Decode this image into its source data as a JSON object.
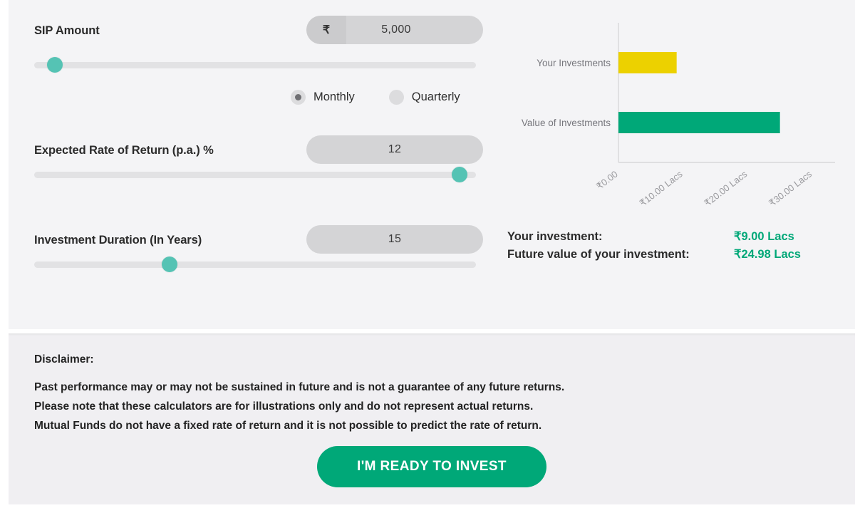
{
  "calculator": {
    "sip_amount": {
      "label": "SIP Amount",
      "currency_symbol": "₹",
      "value": "5,000",
      "slider_percent": 3
    },
    "frequency": {
      "options": [
        {
          "label": "Monthly",
          "selected": true
        },
        {
          "label": "Quarterly",
          "selected": false
        }
      ]
    },
    "rate_of_return": {
      "label": "Expected Rate of Return (p.a.) %",
      "value": "12",
      "slider_percent": 98
    },
    "duration": {
      "label": "Investment Duration (In Years)",
      "value": "15",
      "slider_percent": 30
    }
  },
  "results": {
    "rows": [
      {
        "label": "Your investment:",
        "value": "₹9.00 Lacs"
      },
      {
        "label": "Future value of your investment:",
        "value": "₹24.98 Lacs"
      }
    ]
  },
  "chart_data": {
    "type": "bar",
    "orientation": "horizontal",
    "title": "",
    "xlabel": "",
    "ylabel": "",
    "categories": [
      "Your Investments",
      "Value of Investments"
    ],
    "values": [
      9.0,
      24.98
    ],
    "colors": [
      "#ecd100",
      "#00a878"
    ],
    "xlim": [
      0,
      33.5
    ],
    "tick_values": [
      0,
      10,
      20,
      30
    ],
    "tick_labels": [
      "₹0.00",
      "₹10.00 Lacs",
      "₹20.00 Lacs",
      "₹30.00 Lacs"
    ],
    "tick_label_rotation": -38,
    "grid": false,
    "legend": "none",
    "axis_color": "#d8d8da",
    "tick_label_color": "#9a9a9e",
    "category_label_color": "#76767c",
    "unit": "Lacs"
  },
  "disclaimer": {
    "title": "Disclaimer:",
    "lines": [
      "Past performance may or may not be sustained in future and is not a guarantee of any future returns.",
      "Please note that these calculators are for illustrations only and do not represent actual returns.",
      "Mutual Funds do not have a fixed rate of return and it is not possible to predict the rate of return."
    ]
  },
  "cta": {
    "label": "I'M READY TO INVEST"
  },
  "theme": {
    "accent_green": "#00a878",
    "slider_thumb": "#55c3b4",
    "bar_yellow": "#ecd100",
    "panel_bg": "#f4f4f6",
    "disclaimer_bg": "#f0eff2"
  }
}
